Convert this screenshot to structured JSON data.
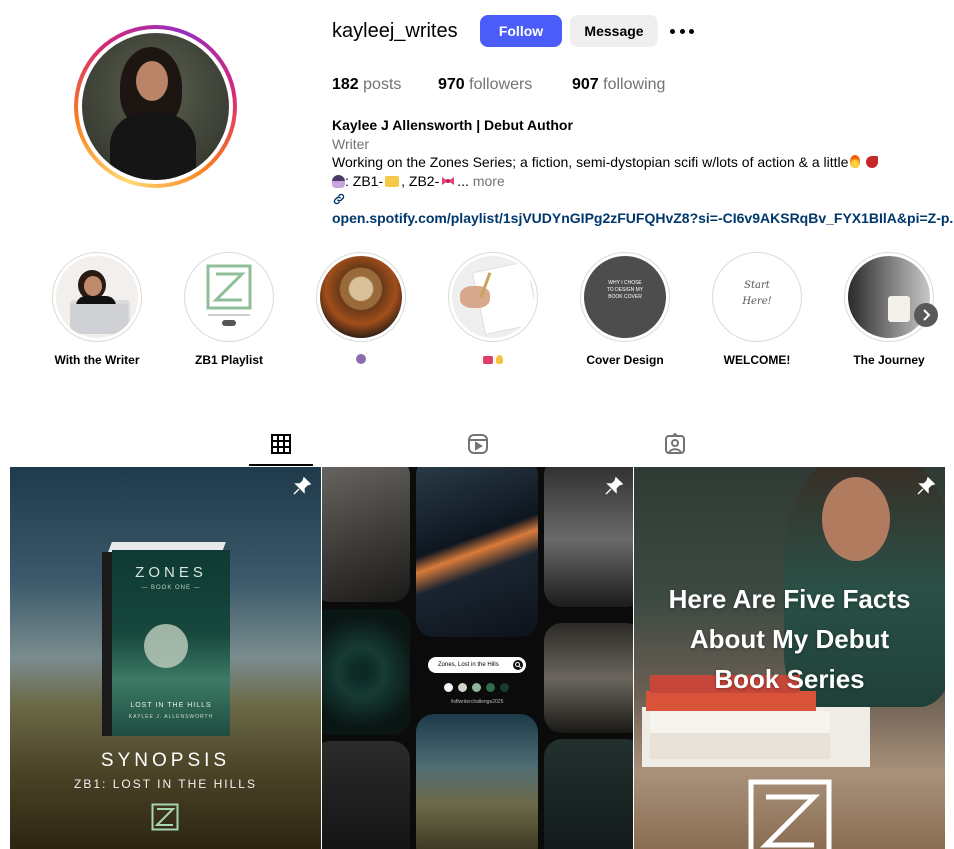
{
  "profile": {
    "username": "kayleej_writes",
    "follow_label": "Follow",
    "message_label": "Message",
    "posts_count": "182",
    "posts_label": "posts",
    "followers_count": "970",
    "followers_label": "followers",
    "following_count": "907",
    "following_label": "following"
  },
  "bio": {
    "name": "Kaylee J Allensworth | Debut Author",
    "category": "Writer",
    "line1": "Working on the Zones Series; a fiction, semi-dystopian scifi w/lots of action & a little",
    "line2_a": ": ZB1-",
    "line2_b": ", ZB2-",
    "line2_c": "...",
    "more_label": "more",
    "link": "open.spotify.com/playlist/1sjVUDYnGIPg2zFUFQHvZ8?si=-CI6v9AKSRqBv_FYX1BIlA&pi=Z-p..."
  },
  "highlights": [
    {
      "label": "With the Writer"
    },
    {
      "label": "ZB1 Playlist"
    },
    {
      "label": ""
    },
    {
      "label": ""
    },
    {
      "label": "Cover Design"
    },
    {
      "label": "WELCOME!"
    },
    {
      "label": "The Journey"
    }
  ],
  "highlight_art": {
    "cover_design_text": "WHY I CHOSE\nTO DESIGN MY\nBOOK COVER",
    "welcome_text": "Start\nHere!"
  },
  "tabs": [
    {
      "name": "posts",
      "icon": "grid-icon",
      "active": true
    },
    {
      "name": "reels",
      "icon": "reels-icon",
      "active": false
    },
    {
      "name": "tagged",
      "icon": "tagged-icon",
      "active": false
    }
  ],
  "posts": {
    "post1": {
      "book_title": "ZONES",
      "book_sub": "— BOOK ONE —",
      "book_lost": "LOST IN THE HILLS",
      "book_author": "KAYLEE J. ALLENSWORTH",
      "heading": "SYNOPSIS",
      "subheading": "ZB1: LOST IN THE HILLS"
    },
    "post2": {
      "search_text": "Zones, Lost in the Hills",
      "hashtag": "#sffwriterchallenge2025",
      "swatches": [
        "#f4f4f4",
        "#cfd8c8",
        "#8fb59a",
        "#2f6d4f",
        "#173b2c"
      ]
    },
    "post3": {
      "line1": "Here Are Five Facts",
      "line2": "About My Debut",
      "line3": "Book Series"
    }
  },
  "colors": {
    "follow_button": "#4a5df9",
    "link": "#00376b",
    "secondary_text": "#737373"
  }
}
